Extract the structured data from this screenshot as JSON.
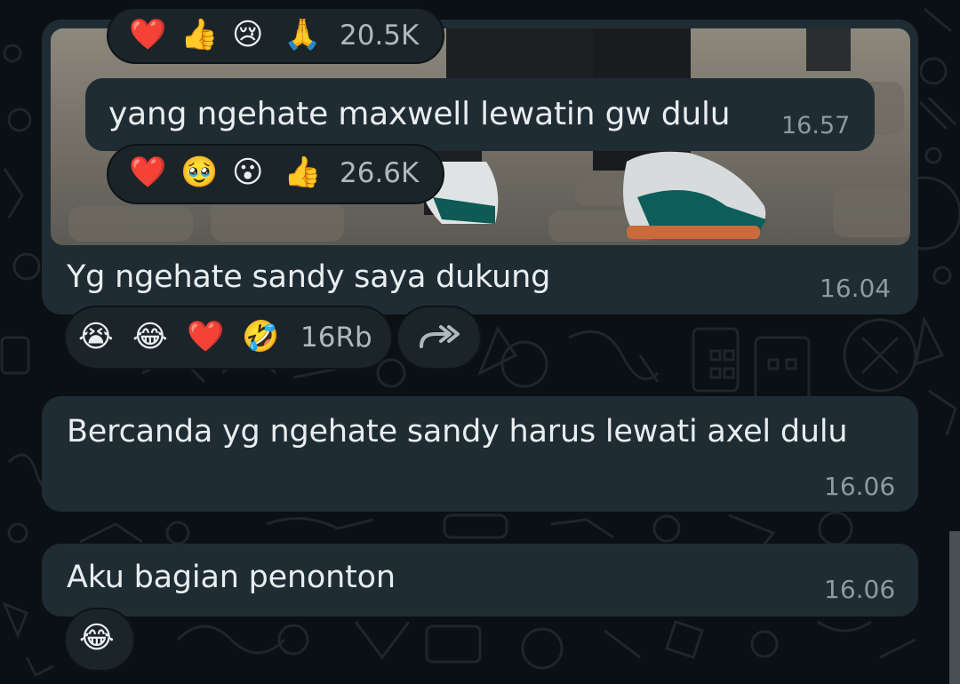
{
  "quoted": {
    "top_reaction_emojis": [
      "❤️",
      "👍",
      "😢",
      "🙏"
    ],
    "top_reaction_count": "20.5K",
    "message_text": "yang ngehate maxwell lewatin gw dulu",
    "message_time": "16.57",
    "reaction_emojis": [
      "❤️",
      "🥹",
      "😮",
      "👍"
    ],
    "reaction_count": "26.6K"
  },
  "messages": [
    {
      "text": "Yg ngehate sandy saya dukung",
      "time": "16.04",
      "reaction_emojis": [
        "😭",
        "😂",
        "❤️",
        "🤣"
      ],
      "reaction_count": "16Rb",
      "forward_icon": "forward-arrow-icon"
    },
    {
      "text": "Bercanda yg ngehate sandy harus lewati axel dulu",
      "time": "16.06"
    },
    {
      "text": "Aku bagian penonton",
      "time": "16.06",
      "reaction_emojis": [
        "😂"
      ]
    }
  ],
  "colors": {
    "background": "#0b1014",
    "bubble": "#1f2c34",
    "timestamp": "#8d9aa1",
    "text": "#e9edef"
  }
}
